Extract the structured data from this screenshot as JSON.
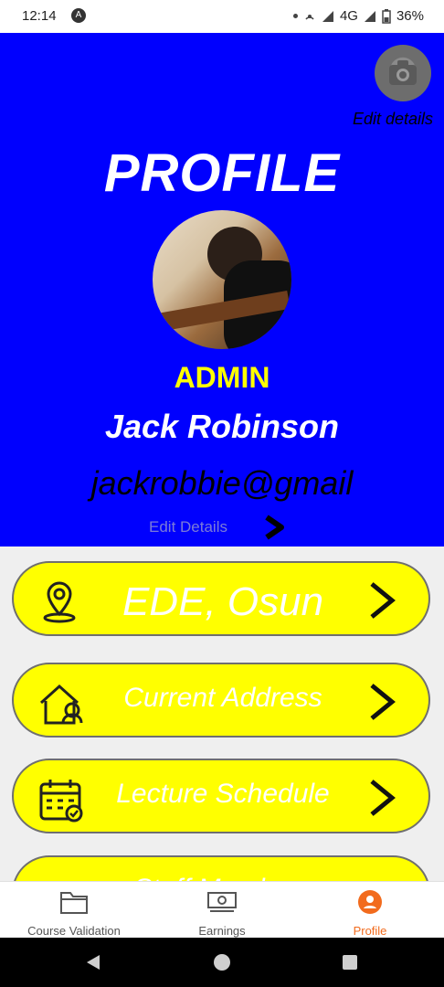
{
  "status_bar": {
    "time": "12:14",
    "app_indicator": "A",
    "network": "4G",
    "battery": "36%"
  },
  "header": {
    "edit_small_label": "Edit details",
    "title": "PROFILE",
    "role": "ADMIN",
    "name": "Jack Robinson",
    "email": "jackrobbie@gmail",
    "edit_link": "Edit Details",
    "colors": {
      "background": "#0000fe",
      "role": "#ffff00"
    }
  },
  "menu": {
    "items": [
      {
        "label": "EDE, Osun",
        "icon": "location-pin-icon"
      },
      {
        "label": "Current Address",
        "icon": "house-icon"
      },
      {
        "label": "Lecture Schedule",
        "icon": "calendar-icon"
      },
      {
        "label": "Staff Members",
        "icon": "people-icon"
      }
    ],
    "colors": {
      "card": "#ffff00",
      "text": "#ffffff"
    }
  },
  "bottom_nav": {
    "items": [
      {
        "label": "Course Validation",
        "icon": "folder-icon",
        "active": false
      },
      {
        "label": "Earnings",
        "icon": "money-icon",
        "active": false
      },
      {
        "label": "Profile",
        "icon": "profile-icon",
        "active": true
      }
    ],
    "active_color": "#f26b1d"
  }
}
